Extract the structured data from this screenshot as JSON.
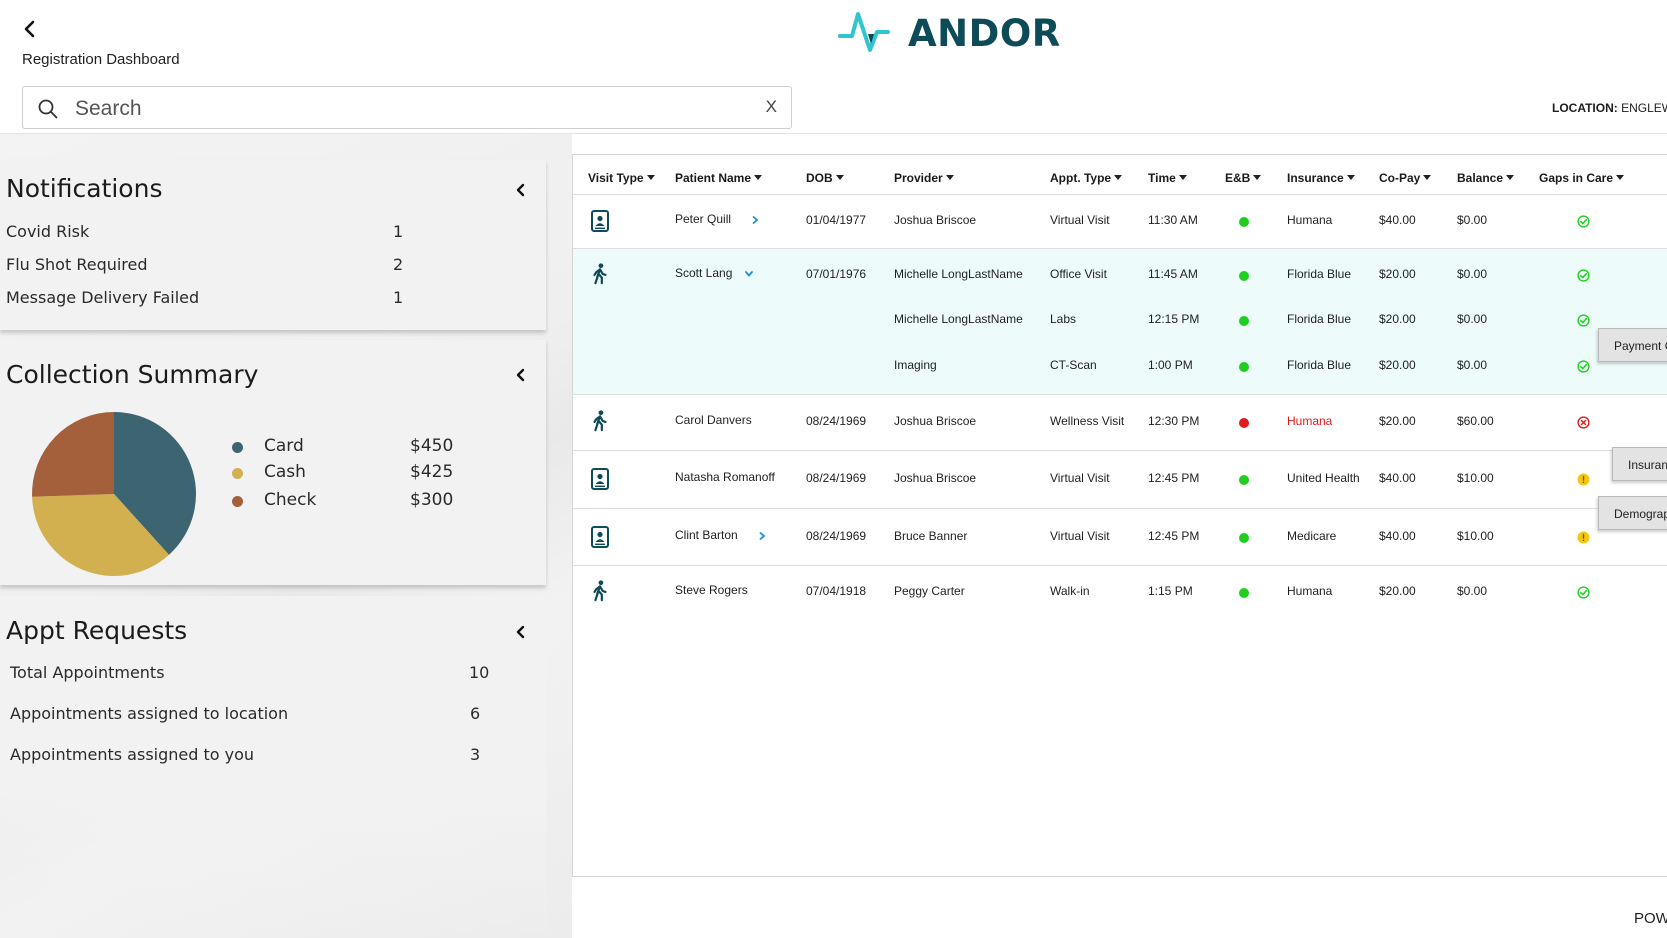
{
  "app": {
    "logo_text": "ANDOR",
    "page_title": "Registration Dashboard",
    "location_label": "LOCATION:",
    "location_value": "ENGLEWO",
    "powered_text": "POW"
  },
  "search": {
    "placeholder": "Search",
    "value": "",
    "clear_label": "X"
  },
  "notifications": {
    "title": "Notifications",
    "items": [
      {
        "label": "Covid Risk",
        "count": "1"
      },
      {
        "label": "Flu Shot Required",
        "count": "2"
      },
      {
        "label": "Message Delivery Failed",
        "count": "1"
      }
    ]
  },
  "collection_summary": {
    "title": "Collection Summary",
    "chart_data": {
      "type": "pie",
      "title": "",
      "categories": [
        "Card",
        "Cash",
        "Check"
      ],
      "values": [
        450,
        425,
        300
      ],
      "value_labels": [
        "$450",
        "$425",
        "$300"
      ],
      "colors": [
        "#3d6571",
        "#d3b04f",
        "#a45f3b"
      ],
      "legend_position": "right"
    }
  },
  "appt_requests": {
    "title": "Appt Requests",
    "items": [
      {
        "label": "Total Appointments",
        "count": "10"
      },
      {
        "label": "Appointments assigned to location",
        "count": "6"
      },
      {
        "label": "Appointments assigned to you",
        "count": "3"
      }
    ]
  },
  "table": {
    "columns": [
      "Visit Type",
      "Patient Name",
      "DOB",
      "Provider",
      "Appt. Type",
      "Time",
      "E&B",
      "Insurance",
      "Co-Pay",
      "Balance",
      "Gaps in Care"
    ],
    "rows": [
      {
        "visit_icon": "tablet-icon",
        "patient": "Peter Quill",
        "chevron": "right",
        "dob": "01/04/1977",
        "provider": "Joshua Briscoe",
        "appt_type": "Virtual Visit",
        "time": "11:30 AM",
        "eb": "green",
        "insurance": "Humana",
        "insurance_alert": false,
        "copay": "$40.00",
        "balance": "$0.00",
        "gaps": "ok"
      },
      {
        "visit_icon": "walk-icon",
        "patient": "Scott Lang",
        "chevron": "down",
        "dob": "07/01/1976",
        "provider": "Michelle LongLastName",
        "appt_type": "Office Visit",
        "time": "11:45 AM",
        "eb": "green",
        "insurance": "Florida Blue",
        "insurance_alert": false,
        "copay": "$20.00",
        "balance": "$0.00",
        "gaps": "ok"
      },
      {
        "visit_icon": "",
        "patient": "",
        "chevron": "",
        "dob": "",
        "provider": "Michelle LongLastName",
        "appt_type": "Labs",
        "time": "12:15 PM",
        "eb": "green",
        "insurance": "Florida Blue",
        "insurance_alert": false,
        "copay": "$20.00",
        "balance": "$0.00",
        "gaps": "ok"
      },
      {
        "visit_icon": "",
        "patient": "",
        "chevron": "",
        "dob": "",
        "provider": "Imaging",
        "appt_type": "CT-Scan",
        "time": "1:00 PM",
        "eb": "green",
        "insurance": "Florida Blue",
        "insurance_alert": false,
        "copay": "$20.00",
        "balance": "$0.00",
        "gaps": "ok"
      },
      {
        "visit_icon": "walk-icon",
        "patient": "Carol Danvers",
        "chevron": "",
        "dob": "08/24/1969",
        "provider": "Joshua Briscoe",
        "appt_type": "Wellness Visit",
        "time": "12:30 PM",
        "eb": "red",
        "insurance": "Humana",
        "insurance_alert": true,
        "copay": "$20.00",
        "balance": "$60.00",
        "gaps": "error"
      },
      {
        "visit_icon": "tablet-icon",
        "patient": "Natasha Romanoff",
        "chevron": "",
        "dob": "08/24/1969",
        "provider": "Joshua Briscoe",
        "appt_type": "Virtual Visit",
        "time": "12:45 PM",
        "eb": "green",
        "insurance": "United Health",
        "insurance_alert": false,
        "copay": "$40.00",
        "balance": "$10.00",
        "gaps": "warning"
      },
      {
        "visit_icon": "tablet-icon",
        "patient": "Clint Barton",
        "chevron": "right",
        "dob": "08/24/1969",
        "provider": "Bruce Banner",
        "appt_type": "Virtual Visit",
        "time": "12:45 PM",
        "eb": "green",
        "insurance": "Medicare",
        "insurance_alert": false,
        "copay": "$40.00",
        "balance": "$10.00",
        "gaps": "warning"
      },
      {
        "visit_icon": "walk-icon",
        "patient": "Steve Rogers",
        "chevron": "",
        "dob": "07/04/1918",
        "provider": "Peggy Carter",
        "appt_type": "Walk-in",
        "time": "1:15 PM",
        "eb": "green",
        "insurance": "Humana",
        "insurance_alert": false,
        "copay": "$20.00",
        "balance": "$0.00",
        "gaps": "ok"
      }
    ]
  },
  "side_buttons": [
    {
      "label": "Payment C"
    },
    {
      "label": "Insuran"
    },
    {
      "label": "Demograp"
    }
  ],
  "colors": {
    "brand_dark": "#0e4b58",
    "brand_accent": "#2ec4d0",
    "status_green": "#1fcf1f",
    "status_red": "#e01b1b",
    "status_yellow": "#f2c811",
    "expanded_row_bg": "#eefbfb",
    "chevron_blue": "#1d8fd4"
  }
}
